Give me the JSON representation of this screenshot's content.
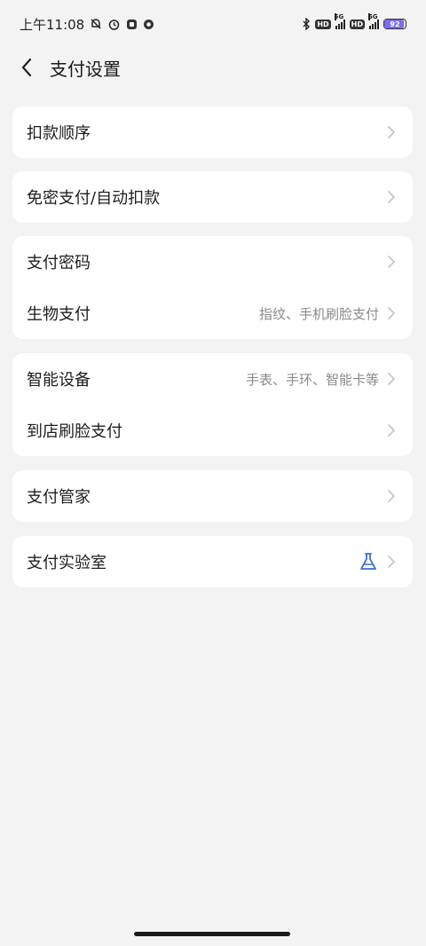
{
  "status_bar": {
    "time": "上午11:08",
    "battery": "92",
    "network": "5G",
    "hd": "HD"
  },
  "header": {
    "title": "支付设置"
  },
  "groups": [
    {
      "items": [
        {
          "label": "扣款顺序",
          "value": ""
        }
      ]
    },
    {
      "items": [
        {
          "label": "免密支付/自动扣款",
          "value": ""
        }
      ]
    },
    {
      "items": [
        {
          "label": "支付密码",
          "value": ""
        },
        {
          "label": "生物支付",
          "value": "指纹、手机刷脸支付"
        }
      ]
    },
    {
      "items": [
        {
          "label": "智能设备",
          "value": "手表、手环、智能卡等"
        },
        {
          "label": "到店刷脸支付",
          "value": ""
        }
      ]
    },
    {
      "items": [
        {
          "label": "支付管家",
          "value": ""
        }
      ]
    },
    {
      "items": [
        {
          "label": "支付实验室",
          "value": "",
          "icon": "flask-icon"
        }
      ]
    }
  ],
  "colors": {
    "accent": "#3b6ed8",
    "background": "#f3f3f3",
    "card": "#ffffff"
  }
}
